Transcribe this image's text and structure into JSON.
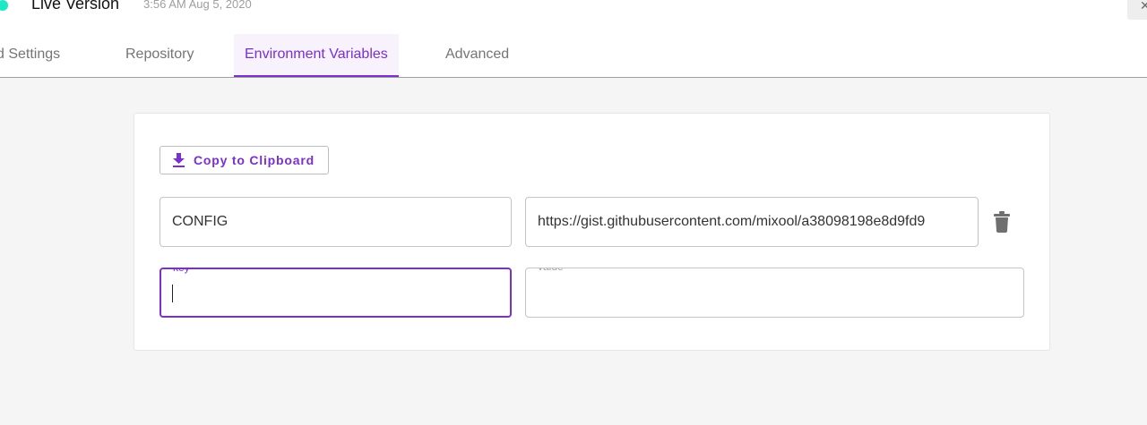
{
  "header": {
    "title": "Live Version",
    "timestamp": "3:56 AM Aug 5, 2020",
    "status_color": "#1de9c4",
    "close_icon": "close-icon"
  },
  "tabs": [
    {
      "label": "d Settings",
      "active": false
    },
    {
      "label": "Repository",
      "active": false
    },
    {
      "label": "Environment Variables",
      "active": true
    },
    {
      "label": "Advanced",
      "active": false
    }
  ],
  "env": {
    "copy_button": {
      "label": "Copy to Clipboard",
      "icon": "download-icon"
    },
    "rows": [
      {
        "key": "CONFIG",
        "value": "https://gist.githubusercontent.com/mixool/a38098198e8d9fd9",
        "delete_icon": "trash-icon"
      }
    ],
    "new_row": {
      "key_label": "key",
      "value_label": "value",
      "key_value": "",
      "value_value": ""
    }
  },
  "colors": {
    "accent": "#7a2fd0",
    "background": "#f5f5f5"
  }
}
